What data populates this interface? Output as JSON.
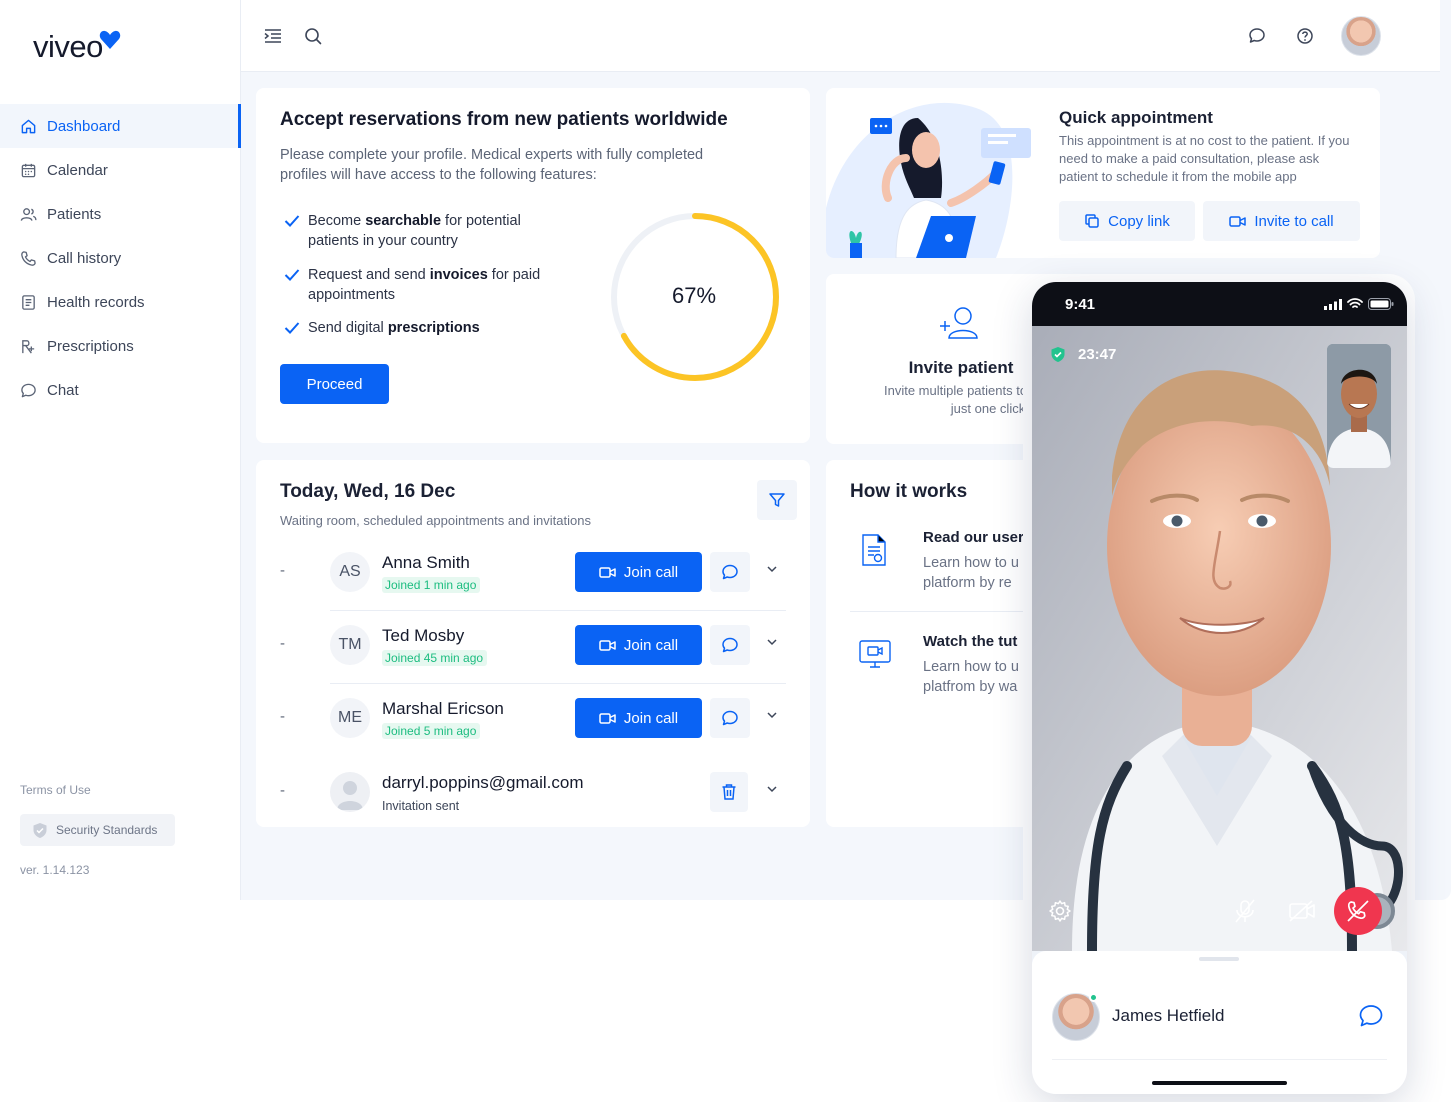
{
  "brand": {
    "name": "viveo",
    "accent": "#0a63f4"
  },
  "sidebar": {
    "items": [
      {
        "label": "Dashboard",
        "icon": "home-icon",
        "active": true
      },
      {
        "label": "Calendar",
        "icon": "calendar-icon"
      },
      {
        "label": "Patients",
        "icon": "patients-icon"
      },
      {
        "label": "Call history",
        "icon": "phone-icon"
      },
      {
        "label": "Health records",
        "icon": "document-icon"
      },
      {
        "label": "Prescriptions",
        "icon": "prescription-icon"
      },
      {
        "label": "Chat",
        "icon": "chat-icon"
      }
    ],
    "terms": "Terms of Use",
    "security": "Security Standards",
    "version": "ver. 1.14.123"
  },
  "accept": {
    "title": "Accept reservations from new patients worldwide",
    "intro": "Please complete your profile. Medical experts with fully completed profiles will have access to the following features:",
    "features": [
      {
        "pre": "Become ",
        "bold": "searchable",
        "post": " for potential patients in your country"
      },
      {
        "pre": "Request and send ",
        "bold": "invoices",
        "post": " for paid appointments"
      },
      {
        "pre": "Send digital ",
        "bold": "prescriptions",
        "post": ""
      }
    ],
    "button": "Proceed",
    "progress": 0.67,
    "progress_label": "67%"
  },
  "quick": {
    "title": "Quick appointment",
    "description": "This appointment is at no cost to the patient. If you need to make a paid consultation, please ask patient to schedule it from the mobile app",
    "copy_label": "Copy link",
    "invite_label": "Invite to call"
  },
  "invite": {
    "title": "Invite patient",
    "line1": "Invite multiple patients to Vi",
    "line2": "just one click"
  },
  "today": {
    "title": "Today, Wed, 16 Dec",
    "subtitle": "Waiting room, scheduled appointments and invitations",
    "rows": [
      {
        "dash": "-",
        "initials": "AS",
        "name": "Anna Smith",
        "status": "Joined 1 min ago",
        "action": "Join call"
      },
      {
        "dash": "-",
        "initials": "TM",
        "name": "Ted Mosby",
        "status": "Joined 45 min ago",
        "action": "Join call"
      },
      {
        "dash": "-",
        "initials": "ME",
        "name": "Marshal Ericson",
        "status": "Joined 5 min ago",
        "action": "Join call"
      },
      {
        "dash": "-",
        "name": "darryl.poppins@gmail.com",
        "status": "Invitation sent"
      }
    ]
  },
  "how": {
    "title": "How it works",
    "items": [
      {
        "title": "Read our user",
        "line1": "Learn how to u",
        "line2": "platform by re"
      },
      {
        "title": "Watch the tut",
        "line1": "Learn how to u",
        "line2": "platfrom by wa"
      }
    ]
  },
  "phone": {
    "time": "9:41",
    "call_timer": "23:47",
    "caller_name": "James Hetfield",
    "end_call_color": "#f0364f"
  }
}
